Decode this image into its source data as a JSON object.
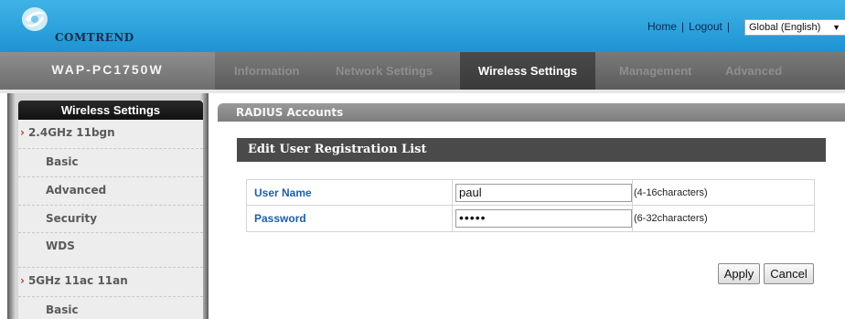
{
  "header": {
    "brand": "COMTREND",
    "links": {
      "home": "Home",
      "separator": "|",
      "logout": "Logout"
    },
    "language": "Global (English)"
  },
  "nav": {
    "model": "WAP-PC1750W",
    "tabs": [
      {
        "label": "Information"
      },
      {
        "label": "Network Settings"
      },
      {
        "label": "Wireless Settings",
        "active": true
      },
      {
        "label": "Management"
      },
      {
        "label": "Advanced"
      }
    ]
  },
  "sidebar": {
    "title": "Wireless Settings",
    "groups": [
      {
        "label": "2.4GHz 11bgn",
        "items": [
          "Basic",
          "Advanced",
          "Security",
          "WDS"
        ]
      },
      {
        "label": "5GHz 11ac 11an",
        "items": [
          "Basic"
        ]
      }
    ]
  },
  "main": {
    "panel_title": "RADIUS Accounts",
    "section_title": "Edit User Registration List",
    "form": {
      "username_label": "User Name",
      "username_value": "paul",
      "username_hint": "(4-16characters)",
      "password_label": "Password",
      "password_value": "•••••",
      "password_hint": "(6-32characters)"
    },
    "buttons": {
      "apply": "Apply",
      "cancel": "Cancel"
    }
  },
  "colors": {
    "header_blue": "#1e93d3",
    "nav_gray": "#5c5c5c",
    "active_tab": "#3a3a3a",
    "label_blue": "#1f5fa8",
    "chevron_orange": "#c8401a"
  }
}
